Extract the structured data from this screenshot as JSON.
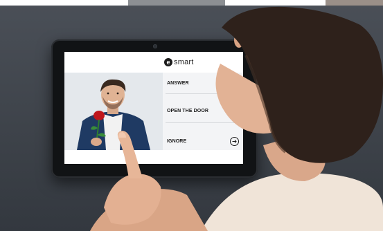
{
  "scene": {
    "description_free": true
  },
  "brand": {
    "logo_letter": "e",
    "logo_text": "smart"
  },
  "actions": [
    {
      "label": "ANSWER",
      "icon": "none"
    },
    {
      "label": "OPEN THE DOOR",
      "icon": "key-icon"
    },
    {
      "label": "IGNORE",
      "icon": "arrow-right-icon"
    }
  ]
}
